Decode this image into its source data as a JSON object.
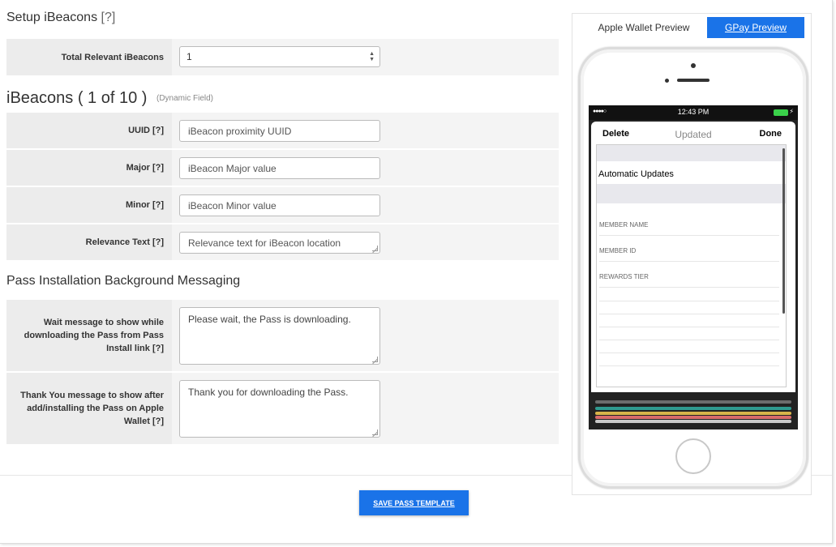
{
  "setup_section": {
    "title": "Setup iBeacons",
    "help": "[?]"
  },
  "total_beacons": {
    "label": "Total Relevant iBeacons",
    "value": "1"
  },
  "ibeacons_section": {
    "title": "iBeacons ( 1 of 10 )",
    "note": "(Dynamic Field)"
  },
  "fields": {
    "uuid": {
      "label": "UUID",
      "help": "[?]",
      "placeholder": "iBeacon proximity UUID"
    },
    "major": {
      "label": "Major",
      "help": "[?]",
      "placeholder": "iBeacon Major value"
    },
    "minor": {
      "label": "Minor",
      "help": "[?]",
      "placeholder": "iBeacon Minor value"
    },
    "relevance": {
      "label": "Relevance Text",
      "help": "[?]",
      "placeholder": "Relevance text for iBeacon location"
    }
  },
  "messaging_section": {
    "title": "Pass Installation Background Messaging"
  },
  "wait_message": {
    "label": "Wait message to show while downloading the Pass from Pass Install link",
    "help": "[?]",
    "value": "Please wait, the Pass is downloading."
  },
  "thanks_message": {
    "label": "Thank You message to show after add/installing the Pass on Apple Wallet",
    "help": "[?]",
    "value": "Thank you for downloading the Pass."
  },
  "save_button": "SAVE PASS TEMPLATE",
  "preview": {
    "tabs": [
      {
        "label": "Apple Wallet Preview"
      },
      {
        "label": "GPay Preview"
      }
    ],
    "status_time": "12:43 PM",
    "signal": "●●●●○",
    "nav": {
      "delete": "Delete",
      "updated": "Updated",
      "done": "Done"
    },
    "automatic_updates": "Automatic Updates",
    "pass_fields": [
      "MEMBER NAME",
      "MEMBER ID",
      "REWARDS TIER"
    ]
  },
  "colors": {
    "accent": "#1a73e8",
    "battery": "#3ad14a"
  }
}
